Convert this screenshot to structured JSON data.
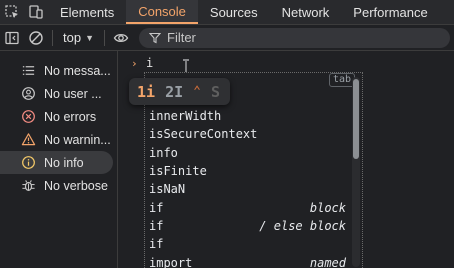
{
  "tabs": [
    {
      "label": "Elements",
      "active": false
    },
    {
      "label": "Console",
      "active": true
    },
    {
      "label": "Sources",
      "active": false
    },
    {
      "label": "Network",
      "active": false
    },
    {
      "label": "Performance",
      "active": false
    }
  ],
  "toolbar": {
    "context": "top",
    "filter_placeholder": "Filter"
  },
  "sidebar": {
    "items": [
      {
        "label": "No messa...",
        "icon": "list-icon"
      },
      {
        "label": "No user ...",
        "icon": "user-icon"
      },
      {
        "label": "No errors",
        "icon": "error-icon"
      },
      {
        "label": "No warnin...",
        "icon": "warning-icon"
      },
      {
        "label": "No info",
        "icon": "info-icon",
        "selected": true
      },
      {
        "label": "No verbose",
        "icon": "bug-icon"
      }
    ]
  },
  "console": {
    "prompt": "›",
    "input": "i",
    "tab_hint": "tab",
    "badge": {
      "k1": "1i",
      "k2": "2I",
      "k3": "⌃",
      "k4": "S"
    },
    "suggestions": [
      {
        "label": "innerWidth",
        "hint": ""
      },
      {
        "label": "isSecureContext",
        "hint": ""
      },
      {
        "label": "info",
        "hint": ""
      },
      {
        "label": "isFinite",
        "hint": ""
      },
      {
        "label": "isNaN",
        "hint": ""
      },
      {
        "label": "if",
        "hint": "block"
      },
      {
        "label": "if",
        "hint": "/ else block"
      },
      {
        "label": "if",
        "hint": ""
      },
      {
        "label": "import",
        "hint": "named"
      }
    ]
  },
  "colors": {
    "accent": "#f3a46a",
    "background": "#202124",
    "tabbar": "#292a2d"
  }
}
